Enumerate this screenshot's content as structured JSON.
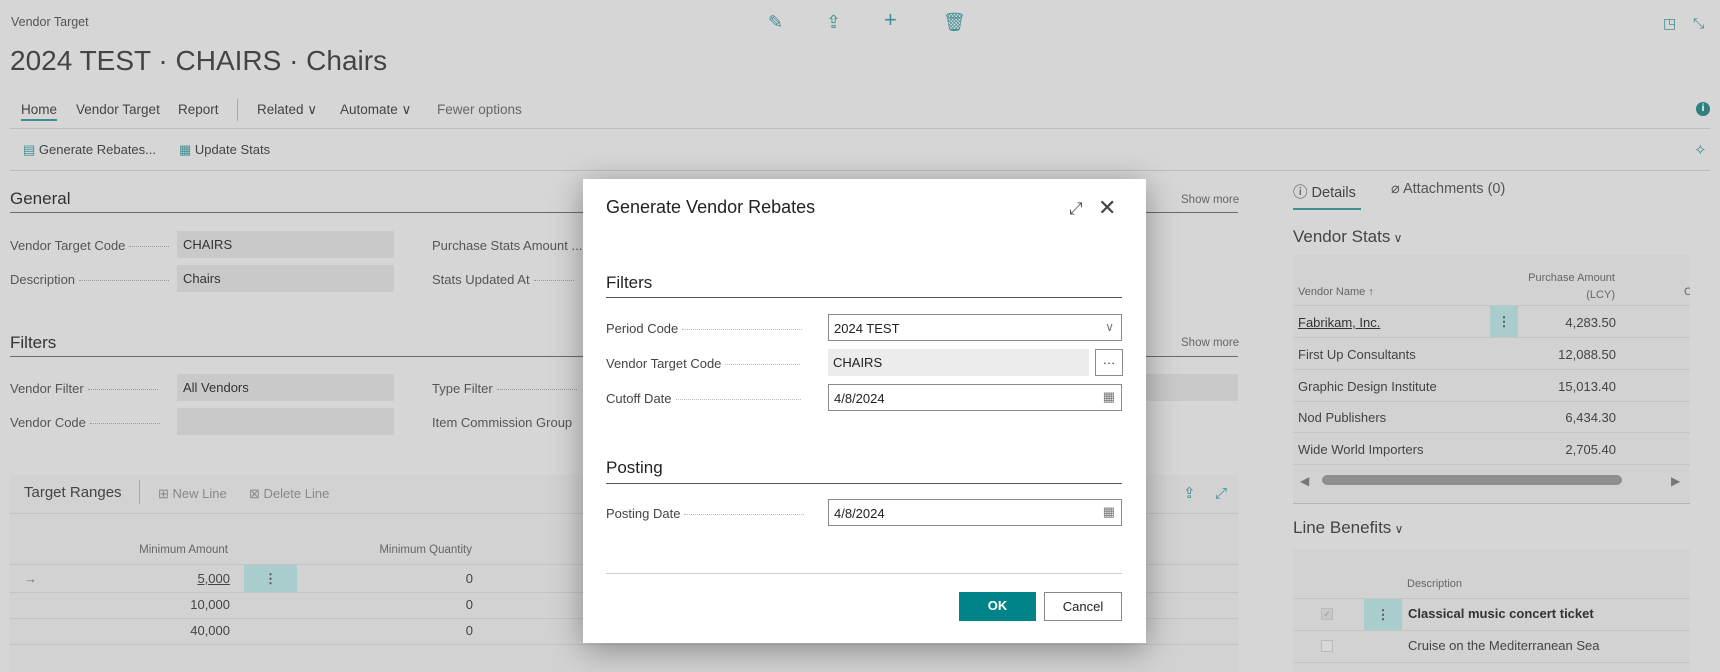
{
  "header": {
    "breadcrumb": "Vendor Target",
    "title": "2024 TEST · CHAIRS · Chairs",
    "icons": [
      "edit-icon",
      "share-icon",
      "add-icon",
      "delete-icon",
      "open-new-window-icon",
      "collapse-icon"
    ]
  },
  "tabs": [
    {
      "label": "Home",
      "active": true
    },
    {
      "label": "Vendor Target"
    },
    {
      "label": "Report"
    },
    {
      "label": "Related ∨"
    },
    {
      "label": "Automate ∨"
    },
    {
      "label": "Fewer options"
    }
  ],
  "actions": [
    {
      "label": "Generate Rebates..."
    },
    {
      "label": "Update Stats"
    }
  ],
  "general": {
    "title": "General",
    "show_more": "Show more",
    "fields": [
      {
        "label": "Vendor Target Code",
        "value": "CHAIRS"
      },
      {
        "label": "Description",
        "value": "Chairs"
      },
      {
        "label": "Purchase Stats Amount ...",
        "value": ""
      },
      {
        "label": "Stats Updated At",
        "value": ""
      }
    ]
  },
  "filters": {
    "title": "Filters",
    "show_more": "Show more",
    "fields": [
      {
        "label": "Vendor Filter",
        "value": "All Vendors"
      },
      {
        "label": "Vendor Code",
        "value": ""
      },
      {
        "label": "Type Filter",
        "value": ""
      },
      {
        "label": "Item Commission Group",
        "value": ""
      }
    ]
  },
  "target_ranges": {
    "title": "Target Ranges",
    "new_line": "New Line",
    "delete_line": "Delete Line",
    "columns": [
      "Minimum Amount",
      "Minimum Quantity"
    ],
    "rows": [
      [
        "5,000",
        "0"
      ],
      [
        "10,000",
        "0"
      ],
      [
        "40,000",
        "0"
      ]
    ]
  },
  "factbox": {
    "tabs": [
      "Details",
      "Attachments (0)"
    ],
    "vendor_stats": {
      "title": "Vendor Stats",
      "columns": [
        "Vendor Name ↑",
        "Purchase Amount",
        "(LCY)",
        "C"
      ],
      "rows": [
        [
          "Fabrikam, Inc.",
          "4,283.50"
        ],
        [
          "First Up Consultants",
          "12,088.50"
        ],
        [
          "Graphic Design Institute",
          "15,013.40"
        ],
        [
          "Nod Publishers",
          "6,434.30"
        ],
        [
          "Wide World Importers",
          "2,705.40"
        ]
      ]
    },
    "line_benefits": {
      "title": "Line Benefits",
      "columns": [
        "Description"
      ],
      "rows": [
        {
          "desc": "Classical music concert ticket",
          "checked": true
        },
        {
          "desc": "Cruise on the Mediterranean Sea",
          "checked": false
        }
      ]
    }
  },
  "dialog": {
    "title": "Generate Vendor Rebates",
    "filters_title": "Filters",
    "posting_title": "Posting",
    "period_code": {
      "label": "Period Code",
      "value": "2024 TEST"
    },
    "vendor_target_code": {
      "label": "Vendor Target Code",
      "value": "CHAIRS"
    },
    "cutoff_date": {
      "label": "Cutoff Date",
      "value": "4/8/2024"
    },
    "posting_date": {
      "label": "Posting Date",
      "value": "4/8/2024"
    },
    "ok": "OK",
    "cancel": "Cancel"
  },
  "colors": {
    "accent": "#008489",
    "overlay_bg": "#d6d6d6"
  }
}
